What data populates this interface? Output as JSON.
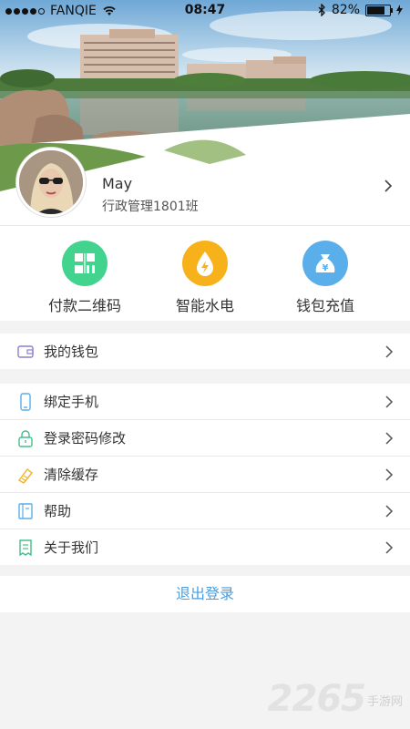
{
  "statusbar": {
    "carrier": "FANQIE",
    "time": "08:47",
    "battery": "82%"
  },
  "profile": {
    "name": "May",
    "class_name": "行政管理1801班"
  },
  "actions": [
    {
      "label": "付款二维码",
      "icon": "qrcode-icon",
      "color": "#42d48f"
    },
    {
      "label": "智能水电",
      "icon": "utility-icon",
      "color": "#f7b21b"
    },
    {
      "label": "钱包充值",
      "icon": "money-bag-icon",
      "color": "#5aaeea"
    }
  ],
  "wallet": {
    "label": "我的钱包"
  },
  "settings": [
    {
      "label": "绑定手机",
      "icon": "phone-icon"
    },
    {
      "label": "登录密码修改",
      "icon": "lock-icon"
    },
    {
      "label": "清除缓存",
      "icon": "broom-icon"
    },
    {
      "label": "帮助",
      "icon": "book-icon"
    },
    {
      "label": "关于我们",
      "icon": "document-icon"
    }
  ],
  "logout": {
    "label": "退出登录"
  },
  "watermark": {
    "number": "2265",
    "text": "手游网"
  },
  "colors": {
    "accent": "#4a9ee0",
    "green": "#42d48f",
    "orange": "#f7b21b",
    "blue": "#5aaeea"
  }
}
